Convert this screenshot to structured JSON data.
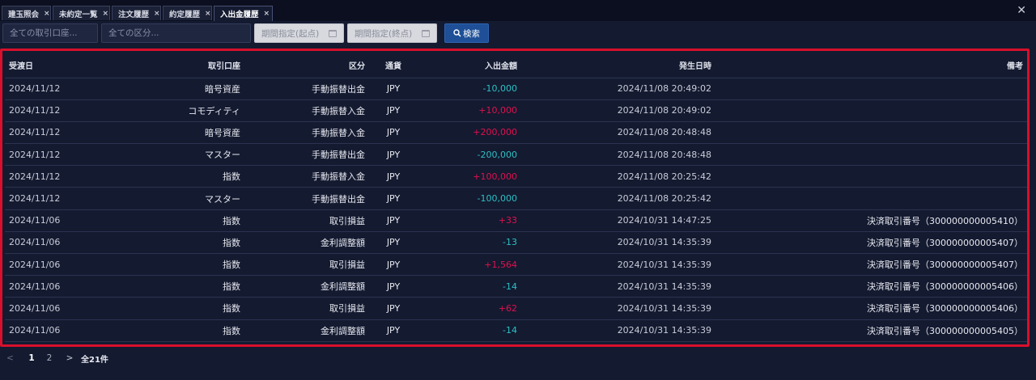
{
  "tabs": [
    {
      "label": "建玉照会",
      "active": false
    },
    {
      "label": "未約定一覧",
      "active": false
    },
    {
      "label": "注文履歴",
      "active": false
    },
    {
      "label": "約定履歴",
      "active": false
    },
    {
      "label": "入出金履歴",
      "active": true
    }
  ],
  "tab_close_glyph": "×",
  "window_close_glyph": "✕",
  "filters": {
    "account_placeholder": "全ての取引口座...",
    "category_placeholder": "全ての区分...",
    "date_from_placeholder": "期間指定(起点)",
    "date_to_placeholder": "期間指定(終点)",
    "search_label": "検索",
    "search_icon": "magnifier-icon"
  },
  "table": {
    "headers": {
      "date": "受渡日",
      "account": "取引口座",
      "category": "区分",
      "currency": "通貨",
      "amount": "入出金額",
      "occurred": "発生日時",
      "note": "備考"
    },
    "rows": [
      {
        "date": "2024/11/12",
        "account": "暗号資産",
        "category": "手動振替出金",
        "currency": "JPY",
        "amount": "-10,000",
        "sign": "neg",
        "occurred": "2024/11/08 20:49:02",
        "note": ""
      },
      {
        "date": "2024/11/12",
        "account": "コモディティ",
        "category": "手動振替入金",
        "currency": "JPY",
        "amount": "+10,000",
        "sign": "pos",
        "occurred": "2024/11/08 20:49:02",
        "note": ""
      },
      {
        "date": "2024/11/12",
        "account": "暗号資産",
        "category": "手動振替入金",
        "currency": "JPY",
        "amount": "+200,000",
        "sign": "pos",
        "occurred": "2024/11/08 20:48:48",
        "note": ""
      },
      {
        "date": "2024/11/12",
        "account": "マスター",
        "category": "手動振替出金",
        "currency": "JPY",
        "amount": "-200,000",
        "sign": "neg",
        "occurred": "2024/11/08 20:48:48",
        "note": ""
      },
      {
        "date": "2024/11/12",
        "account": "指数",
        "category": "手動振替入金",
        "currency": "JPY",
        "amount": "+100,000",
        "sign": "pos",
        "occurred": "2024/11/08 20:25:42",
        "note": ""
      },
      {
        "date": "2024/11/12",
        "account": "マスター",
        "category": "手動振替出金",
        "currency": "JPY",
        "amount": "-100,000",
        "sign": "neg",
        "occurred": "2024/11/08 20:25:42",
        "note": ""
      },
      {
        "date": "2024/11/06",
        "account": "指数",
        "category": "取引損益",
        "currency": "JPY",
        "amount": "+33",
        "sign": "pos",
        "occurred": "2024/10/31 14:47:25",
        "note": "決済取引番号（300000000005410）"
      },
      {
        "date": "2024/11/06",
        "account": "指数",
        "category": "金利調整額",
        "currency": "JPY",
        "amount": "-13",
        "sign": "neg",
        "occurred": "2024/10/31 14:35:39",
        "note": "決済取引番号（300000000005407）"
      },
      {
        "date": "2024/11/06",
        "account": "指数",
        "category": "取引損益",
        "currency": "JPY",
        "amount": "+1,564",
        "sign": "pos",
        "occurred": "2024/10/31 14:35:39",
        "note": "決済取引番号（300000000005407）"
      },
      {
        "date": "2024/11/06",
        "account": "指数",
        "category": "金利調整額",
        "currency": "JPY",
        "amount": "-14",
        "sign": "neg",
        "occurred": "2024/10/31 14:35:39",
        "note": "決済取引番号（300000000005406）"
      },
      {
        "date": "2024/11/06",
        "account": "指数",
        "category": "取引損益",
        "currency": "JPY",
        "amount": "+62",
        "sign": "pos",
        "occurred": "2024/10/31 14:35:39",
        "note": "決済取引番号（300000000005406）"
      },
      {
        "date": "2024/11/06",
        "account": "指数",
        "category": "金利調整額",
        "currency": "JPY",
        "amount": "-14",
        "sign": "neg",
        "occurred": "2024/10/31 14:35:39",
        "note": "決済取引番号（300000000005405）"
      }
    ]
  },
  "pagination": {
    "prev": "<",
    "pages": [
      "1",
      "2"
    ],
    "current": "1",
    "next": ">",
    "total": "全21件"
  },
  "colors": {
    "background": "#141a30",
    "positive": "#e0104e",
    "negative": "#2cc0c4",
    "highlight_frame": "#d8102c",
    "search_button": "#1e4f97"
  }
}
